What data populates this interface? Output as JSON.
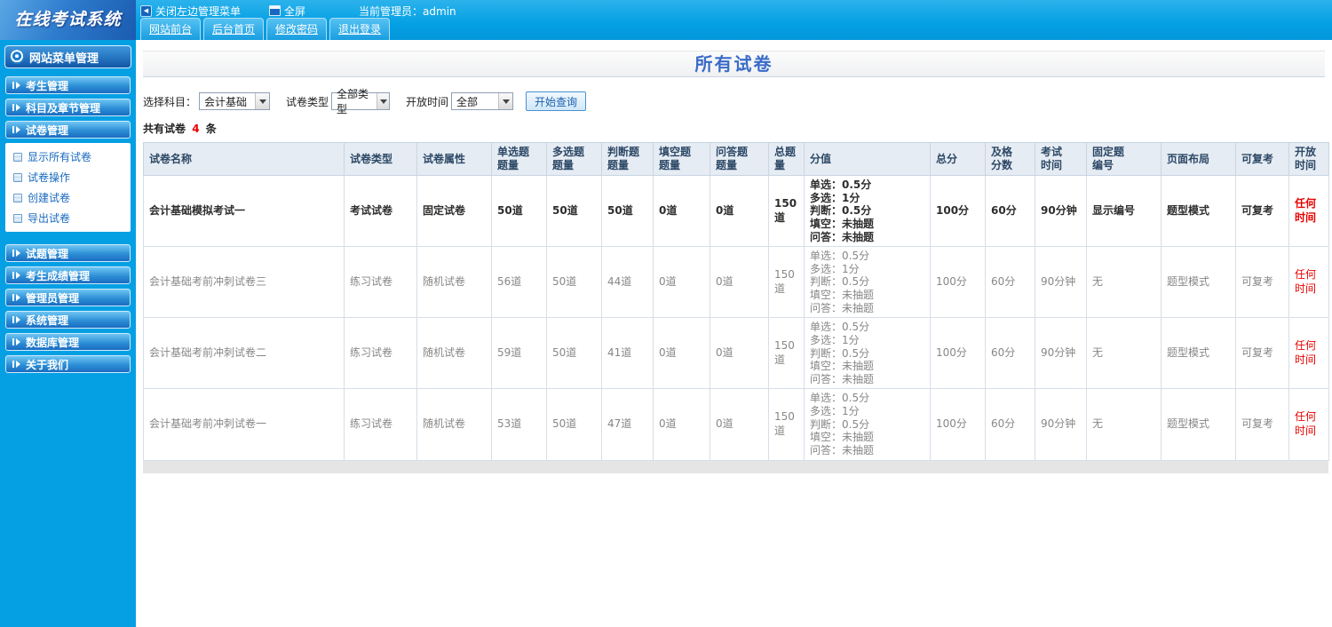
{
  "header": {
    "logo": "在线考试系统",
    "close_menu_label": "关闭左边管理菜单",
    "fullscreen_label": "全屏",
    "admin_label": "当前管理员：admin",
    "tabs": [
      {
        "label": "网站前台"
      },
      {
        "label": "后台首页"
      },
      {
        "label": "修改密码"
      },
      {
        "label": "退出登录"
      }
    ]
  },
  "sidebar": {
    "title": "网站菜单管理",
    "items": [
      {
        "label": "考生管理"
      },
      {
        "label": "科目及章节管理"
      },
      {
        "label": "试卷管理"
      },
      {
        "label": "试题管理"
      },
      {
        "label": "考生成绩管理"
      },
      {
        "label": "管理员管理"
      },
      {
        "label": "系统管理"
      },
      {
        "label": "数据库管理"
      },
      {
        "label": "关于我们"
      }
    ],
    "submenu": [
      {
        "label": "显示所有试卷"
      },
      {
        "label": "试卷操作"
      },
      {
        "label": "创建试卷"
      },
      {
        "label": "导出试卷"
      }
    ]
  },
  "main": {
    "title": "所有试卷",
    "filters": {
      "subject_label": "选择科目：",
      "subject_value": "会计基础",
      "type_label": "试卷类型",
      "type_value": "全部类型",
      "time_label": "开放时间",
      "time_value": "全部",
      "query_button": "开始查询"
    },
    "summary": {
      "prefix": "共有试卷",
      "count": "4",
      "suffix": "条"
    },
    "table": {
      "headers": [
        "试卷名称",
        "试卷类型",
        "试卷属性",
        "单选题\n题量",
        "多选题\n题量",
        "判断题\n题量",
        "填空题\n题量",
        "问答题\n题量",
        "总题量",
        "分值",
        "总分",
        "及格\n分数",
        "考试\n时间",
        "固定题\n编号",
        "页面布局",
        "可复考",
        "开放时间"
      ],
      "rows": [
        {
          "name": "会计基础模拟考试一",
          "type": "考试试卷",
          "attr": "固定试卷",
          "single": "50道",
          "multi": "50道",
          "judge": "50道",
          "fill": "0道",
          "qa": "0道",
          "total": "150道",
          "score": "单选：0.5分\n多选：1分\n判断：0.5分\n填空：未抽题\n问答：未抽题",
          "total_score": "100分",
          "pass_score": "60分",
          "duration": "90分钟",
          "fixed_no": "显示编号",
          "layout": "题型模式",
          "retake": "可复考",
          "open_time": "任何时间"
        },
        {
          "name": "会计基础考前冲刺试卷三",
          "type": "练习试卷",
          "attr": "随机试卷",
          "single": "56道",
          "multi": "50道",
          "judge": "44道",
          "fill": "0道",
          "qa": "0道",
          "total": "150道",
          "score": "单选：0.5分\n多选：1分\n判断：0.5分\n填空：未抽题\n问答：未抽题",
          "total_score": "100分",
          "pass_score": "60分",
          "duration": "90分钟",
          "fixed_no": "无",
          "layout": "题型模式",
          "retake": "可复考",
          "open_time": "任何时间"
        },
        {
          "name": "会计基础考前冲刺试卷二",
          "type": "练习试卷",
          "attr": "随机试卷",
          "single": "59道",
          "multi": "50道",
          "judge": "41道",
          "fill": "0道",
          "qa": "0道",
          "total": "150道",
          "score": "单选：0.5分\n多选：1分\n判断：0.5分\n填空：未抽题\n问答：未抽题",
          "total_score": "100分",
          "pass_score": "60分",
          "duration": "90分钟",
          "fixed_no": "无",
          "layout": "题型模式",
          "retake": "可复考",
          "open_time": "任何时间"
        },
        {
          "name": "会计基础考前冲刺试卷一",
          "type": "练习试卷",
          "attr": "随机试卷",
          "single": "53道",
          "multi": "50道",
          "judge": "47道",
          "fill": "0道",
          "qa": "0道",
          "total": "150道",
          "score": "单选：0.5分\n多选：1分\n判断：0.5分\n填空：未抽题\n问答：未抽题",
          "total_score": "100分",
          "pass_score": "60分",
          "duration": "90分钟",
          "fixed_no": "无",
          "layout": "题型模式",
          "retake": "可复考",
          "open_time": "任何时间"
        }
      ]
    }
  },
  "colors": {
    "top_bar": "#05a0e4",
    "sidebar": "#05a0e4",
    "title_text": "#3a6bc8",
    "alert_red": "#e80000",
    "table_header_bg": "#e6ecf3"
  }
}
